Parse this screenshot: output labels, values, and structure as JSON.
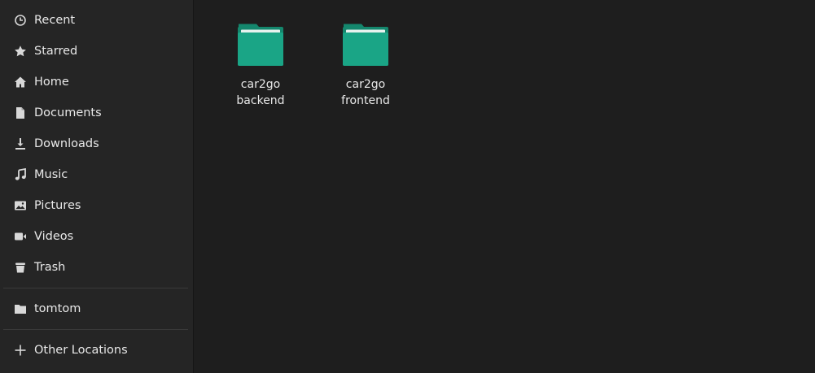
{
  "sidebar": {
    "places": [
      {
        "label": "Recent",
        "icon": "clock-icon"
      },
      {
        "label": "Starred",
        "icon": "star-icon"
      },
      {
        "label": "Home",
        "icon": "home-icon"
      },
      {
        "label": "Documents",
        "icon": "document-icon"
      },
      {
        "label": "Downloads",
        "icon": "download-icon"
      },
      {
        "label": "Music",
        "icon": "music-icon"
      },
      {
        "label": "Pictures",
        "icon": "picture-icon"
      },
      {
        "label": "Videos",
        "icon": "video-icon"
      },
      {
        "label": "Trash",
        "icon": "trash-icon"
      }
    ],
    "bookmarks": [
      {
        "label": "tomtom",
        "icon": "folder-icon"
      }
    ],
    "other": {
      "label": "Other Locations",
      "icon": "plus-icon"
    }
  },
  "files": [
    {
      "line1": "car2go",
      "line2": "backend",
      "icon": "folder-icon"
    },
    {
      "line1": "car2go",
      "line2": "frontend",
      "icon": "folder-icon"
    }
  ],
  "colors": {
    "folder_body": "#1aa586",
    "folder_tab": "#14876d",
    "folder_paper": "#e6f2ee",
    "background": "#1e1e1e",
    "sidebar": "#252525",
    "text": "#e8e8e8"
  }
}
